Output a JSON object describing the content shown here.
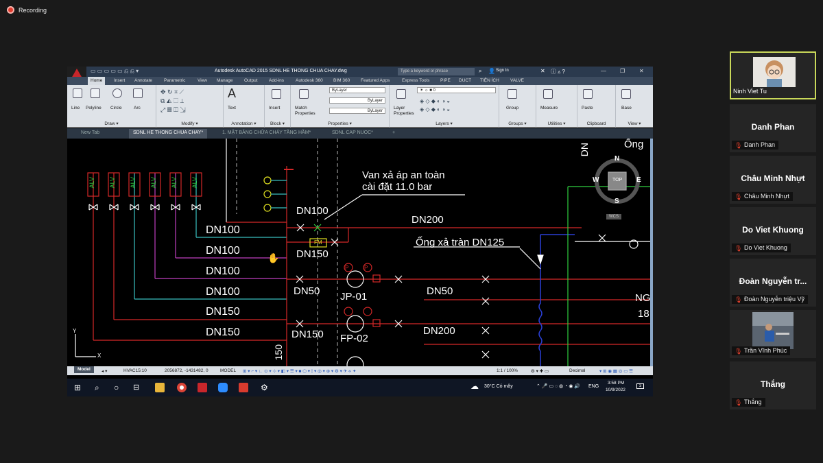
{
  "meeting": {
    "recording_label": "Recording"
  },
  "acad": {
    "window_title": "Autodesk AutoCAD 2015    SDNL HE THONG CHUA CHAY.dwg",
    "search_placeholder": "Type a keyword or phrase",
    "sign_in": "Sign In",
    "ribbon_tabs": [
      "Home",
      "Insert",
      "Annotate",
      "Parametric",
      "View",
      "Manage",
      "Output",
      "Add-ins",
      "Autodesk 360",
      "BIM 360",
      "Featured Apps",
      "Express Tools",
      "PIPE",
      "DUCT",
      "TIỆN ÍCH",
      "VALVE"
    ],
    "tools": {
      "line": "Line",
      "polyline": "Polyline",
      "circle": "Circle",
      "arc": "Arc",
      "text": "Text",
      "insert": "Insert",
      "match": "Match",
      "match2": "Properties",
      "layer": "Layer",
      "layer2": "Properties",
      "group": "Group",
      "measure": "Measure",
      "paste": "Paste",
      "base": "Base"
    },
    "props": {
      "bylayer1": "ByLayer",
      "bylayer2": "ByLayer",
      "bylayer3": "ByLayer"
    },
    "groups": {
      "draw": "Draw ▾",
      "modify": "Modify ▾",
      "annotation": "Annotation ▾",
      "block": "Block ▾",
      "properties": "Properties ▾",
      "layers": "Layers ▾",
      "groups": "Groups ▾",
      "utilities": "Utilities ▾",
      "clipboard": "Clipboard",
      "view": "View ▾"
    },
    "doc_tabs": [
      "New Tab",
      "SDNL HE THONG CHUA CHAY*",
      "1. MẶT BẰNG CHỮA CHÁY TẦNG HẦM*",
      "SDNL CAP NUOC*",
      "+"
    ],
    "status": {
      "model": "Model",
      "layout": "HVAC15:10",
      "coords": "2056872, -1431482, 0",
      "model2": "MODEL",
      "scale": "1:1 / 100%",
      "units": "Decimal"
    }
  },
  "drawing": {
    "alv": [
      "ALV",
      "ALV",
      "ALV",
      "ALV",
      "ALV",
      "ALV"
    ],
    "pipes": [
      "DN100",
      "DN100",
      "DN100",
      "DN100",
      "DN150",
      "DN150"
    ],
    "annot_valve1": "Van xả áp an toàn",
    "annot_valve2": "cài đặt 11.0 bar",
    "dn100": "DN100",
    "dn150": "DN150",
    "dn200": "DN200",
    "overflow": "Ống xả tràn DN125",
    "fm": "FM",
    "dn50a": "DN50",
    "jp": "JP-01",
    "dn50b": "DN50",
    "dn150b": "DN150",
    "fp": "FP-02",
    "dn200b": "DN200",
    "vert150": "150",
    "ong": "Ống",
    "ng": "NG",
    "n18": "18",
    "dn_top": "DN",
    "compass": {
      "n": "N",
      "s": "S",
      "e": "E",
      "w": "W",
      "top": "TOP",
      "wcs": "WCS"
    },
    "p": "P"
  },
  "taskbar": {
    "weather": "30°C  Có mây",
    "lang": "ENG",
    "time": "3:58 PM",
    "date": "10/9/2022",
    "badge": "3"
  },
  "participants": [
    {
      "name": "Ninh Viet Tu"
    },
    {
      "name": "Danh Phan",
      "sub": "Danh Phan"
    },
    {
      "name": "Châu Minh Nhựt",
      "sub": "Châu Minh Nhựt"
    },
    {
      "name": "Do Viet Khuong",
      "sub": "Do Viet Khuong"
    },
    {
      "name": "Đoàn Nguyễn tr...",
      "sub": "Đoàn Nguyễn triệu Vỹ"
    },
    {
      "name": "Trần Vĩnh Phúc",
      "sub": "Trần Vĩnh Phúc"
    },
    {
      "name": "Thắng",
      "sub": "Thắng"
    }
  ]
}
